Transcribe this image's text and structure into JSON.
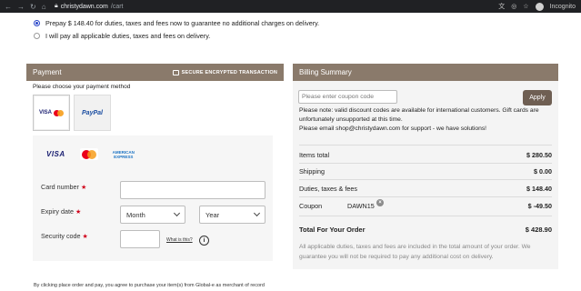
{
  "browser": {
    "url_domain": "christydawn.com",
    "url_path": "/cart",
    "profile_label": "Incognito"
  },
  "duties": {
    "option_prepay": "Prepay $ 148.40 for duties, taxes and fees now to guarantee no additional charges on delivery.",
    "option_pay_later": "I will pay all applicable duties, taxes and fees on delivery.",
    "selected": "prepay"
  },
  "payment": {
    "header": "Payment",
    "secure_label": "SECURE ENCRYPTED TRANSACTION",
    "choose_label": "Please choose your payment method",
    "methods": [
      {
        "label": "VISA",
        "selected": true
      },
      {
        "label": "PayPal",
        "selected": false
      }
    ],
    "card_brands": {
      "visa": "VISA",
      "amex_line1": "AMERICAN",
      "amex_line2": "EXPRESS"
    },
    "fields": {
      "card_number_label": "Card number",
      "expiry_label": "Expiry date",
      "month_value": "Month",
      "year_value": "Year",
      "security_label": "Security code",
      "what_is_this": "What is this?",
      "required_mark": "★"
    }
  },
  "billing": {
    "header": "Billing Summary",
    "coupon_placeholder": "Please enter coupon code",
    "apply_label": "Apply",
    "note_lines": [
      "Please note: valid discount codes are available for international customers. Gift cards are",
      "unfortunately unsupported at this time.",
      "Please email shop@christydawn.com for support - we have solutions!"
    ],
    "rows": [
      {
        "label": "Items total",
        "amount": "$ 280.50"
      },
      {
        "label": "Shipping",
        "amount": "$ 0.00"
      },
      {
        "label": "Duties, taxes & fees",
        "amount": "$ 148.40"
      },
      {
        "label": "Coupon",
        "amount": "$ -49.50"
      }
    ],
    "coupon_code": "DAWN15",
    "total_label": "Total For Your Order",
    "total_amount": "$ 428.90",
    "fine_print_lines": [
      "All applicable duties, taxes and fees are included in the total amount of your order. We",
      "guarantee you will not be required to pay any additional cost on delivery."
    ]
  },
  "footer": {
    "merchant_note": "By clicking place order and pay, you agree to purchase your item(s) from Global-e as merchant of record"
  },
  "colors": {
    "panel_header": "#8a7a6b",
    "apply_button": "#6f5f53",
    "radio_selected": "#2a47c9",
    "required_star": "#d0021b"
  }
}
